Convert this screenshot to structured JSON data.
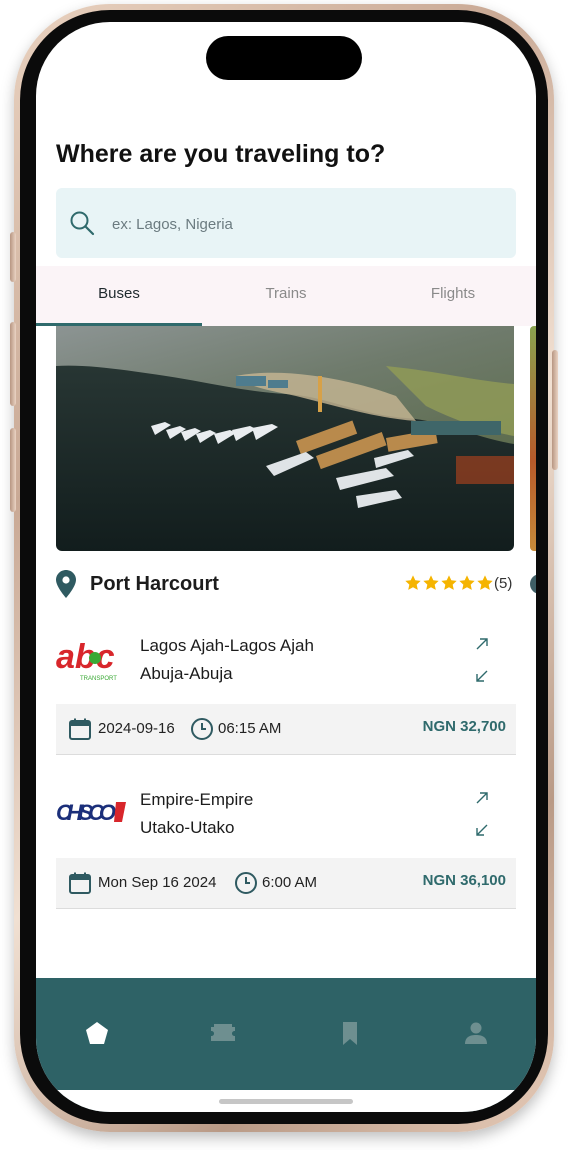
{
  "header": {
    "title": "Where are you traveling to?"
  },
  "search": {
    "placeholder": "ex: Lagos, Nigeria",
    "icon": "search-icon"
  },
  "tabs": [
    {
      "label": "Buses",
      "active": true
    },
    {
      "label": "Trains",
      "active": false
    },
    {
      "label": "Flights",
      "active": false
    }
  ],
  "destination": {
    "name": "Port Harcourt",
    "rating_stars": 5,
    "rating_count": "(5)",
    "image": "aerial harbor photo with yachts"
  },
  "trips": [
    {
      "operator_logo": "abc",
      "operator_logo_sub": "TRANSPORT",
      "from": "Lagos Ajah-Lagos Ajah",
      "to": "Abuja-Abuja",
      "date": "2024-09-16",
      "time": "06:15 AM",
      "price": "NGN 32,700"
    },
    {
      "operator_logo": "CHISCO",
      "from": "Empire-Empire",
      "to": "Utako-Utako",
      "date": "Mon Sep 16 2024",
      "time": "6:00 AM",
      "price": "NGN 36,100"
    }
  ],
  "bottom_nav": [
    {
      "icon": "home-icon",
      "active": true
    },
    {
      "icon": "ticket-icon",
      "active": false
    },
    {
      "icon": "bookmark-icon",
      "active": false
    },
    {
      "icon": "profile-icon",
      "active": false
    }
  ],
  "colors": {
    "accent": "#2f6a6c",
    "nav_bg": "#2e6266",
    "search_bg": "#e8f4f6",
    "star": "#f5b400",
    "tabs_bg": "#fbf4f7"
  }
}
